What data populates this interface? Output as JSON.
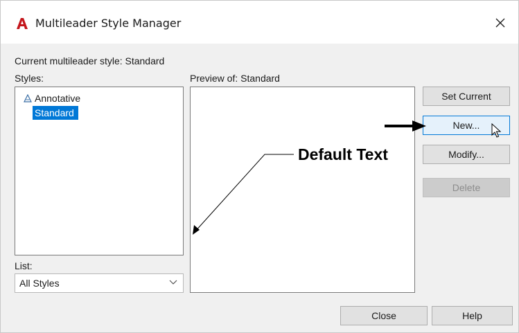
{
  "window": {
    "title": "Multileader Style Manager",
    "close_glyph": "✕",
    "app_icon": "autocad-a-icon",
    "accent_color": "#c4161c"
  },
  "current_style": {
    "label": "Current multileader style: Standard"
  },
  "styles": {
    "label": "Styles:",
    "items": [
      {
        "label": "Annotative",
        "icon": "annotative-icon",
        "selected": false
      },
      {
        "label": "Standard",
        "selected": true
      }
    ],
    "selection_color": "#0078d7"
  },
  "list_filter": {
    "label": "List:",
    "value": "All Styles"
  },
  "preview": {
    "label": "Preview of: Standard",
    "sample_text": "Default Text"
  },
  "buttons": {
    "set_current": "Set Current",
    "new": "New...",
    "modify": "Modify...",
    "delete": "Delete",
    "close": "Close",
    "help": "Help"
  }
}
